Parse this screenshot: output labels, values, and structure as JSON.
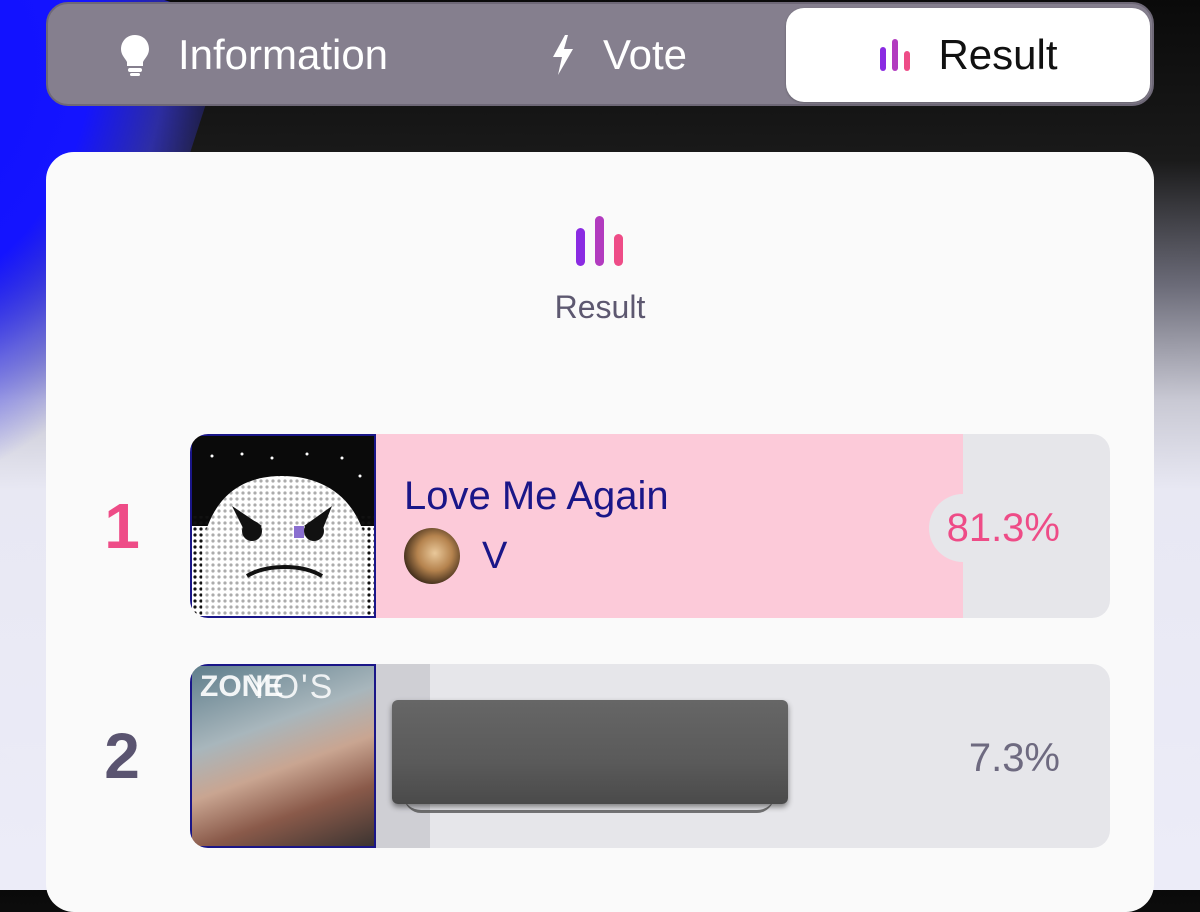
{
  "tabs": [
    {
      "label": "Information",
      "icon": "lightbulb-icon"
    },
    {
      "label": "Vote",
      "icon": "lightning-icon"
    },
    {
      "label": "Result",
      "icon": "bar-chart-icon",
      "active": true
    }
  ],
  "card": {
    "heading_icon": "bar-chart-icon",
    "heading": "Result"
  },
  "results": [
    {
      "rank": "1",
      "title": "Love Me Again",
      "artist": "V",
      "percent": "81.3%",
      "share": 0.813,
      "color": "#ee4c87"
    },
    {
      "rank": "2",
      "percent": "7.3%",
      "share": 0.073,
      "cover_text_vertical": "ZONE",
      "cover_text": "YO'S"
    }
  ],
  "colors": {
    "accent": "#ee4c87",
    "title": "#1a1688",
    "tab_bar": "#857f8e",
    "first_fill": "#fccad9"
  }
}
